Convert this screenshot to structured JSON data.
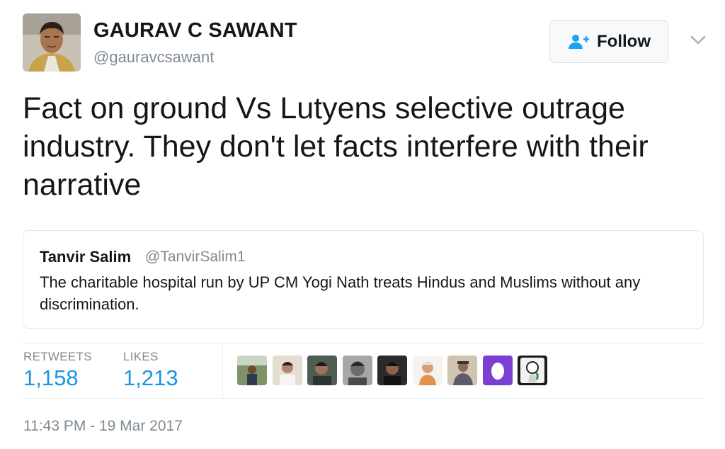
{
  "author": {
    "display_name": "GAURAV C SAWANT",
    "handle": "@gauravcsawant",
    "avatar_icon": "profile-photo"
  },
  "follow_button": {
    "label": "Follow",
    "icon": "add-person-icon",
    "icon_color": "#1da1f2"
  },
  "menu_icon": "chevron-down-icon",
  "tweet": {
    "text": "Fact on ground Vs Lutyens selective outrage industry. They don't let facts interfere with their narrative"
  },
  "quoted_tweet": {
    "display_name": "Tanvir Salim",
    "handle": "@TanvirSalim1",
    "text": "The charitable hospital run by UP CM Yogi Nath treats Hindus and Muslims without any discrimination."
  },
  "stats": {
    "retweets_label": "RETWEETS",
    "retweets_value": "1,158",
    "likes_label": "LIKES",
    "likes_value": "1,213"
  },
  "likers": [
    {
      "name": "liker-avatar-1",
      "bg": "#8a9a70"
    },
    {
      "name": "liker-avatar-2",
      "bg": "#d6cfc4"
    },
    {
      "name": "liker-avatar-3",
      "bg": "#4e5a50"
    },
    {
      "name": "liker-avatar-4",
      "bg": "#8d8d8d"
    },
    {
      "name": "liker-avatar-5",
      "bg": "#2b2b2b"
    },
    {
      "name": "liker-avatar-6",
      "bg": "#f2efe9"
    },
    {
      "name": "liker-avatar-7",
      "bg": "#b8a890"
    },
    {
      "name": "liker-avatar-8",
      "bg": "#7d3fd3"
    },
    {
      "name": "liker-avatar-9",
      "bg": "#1e1e1e"
    }
  ],
  "timestamp": "11:43 PM - 19 Mar 2017",
  "colors": {
    "link_blue": "#1b95e0",
    "muted_gray": "#7f8a93",
    "border": "#e1e8ed"
  }
}
